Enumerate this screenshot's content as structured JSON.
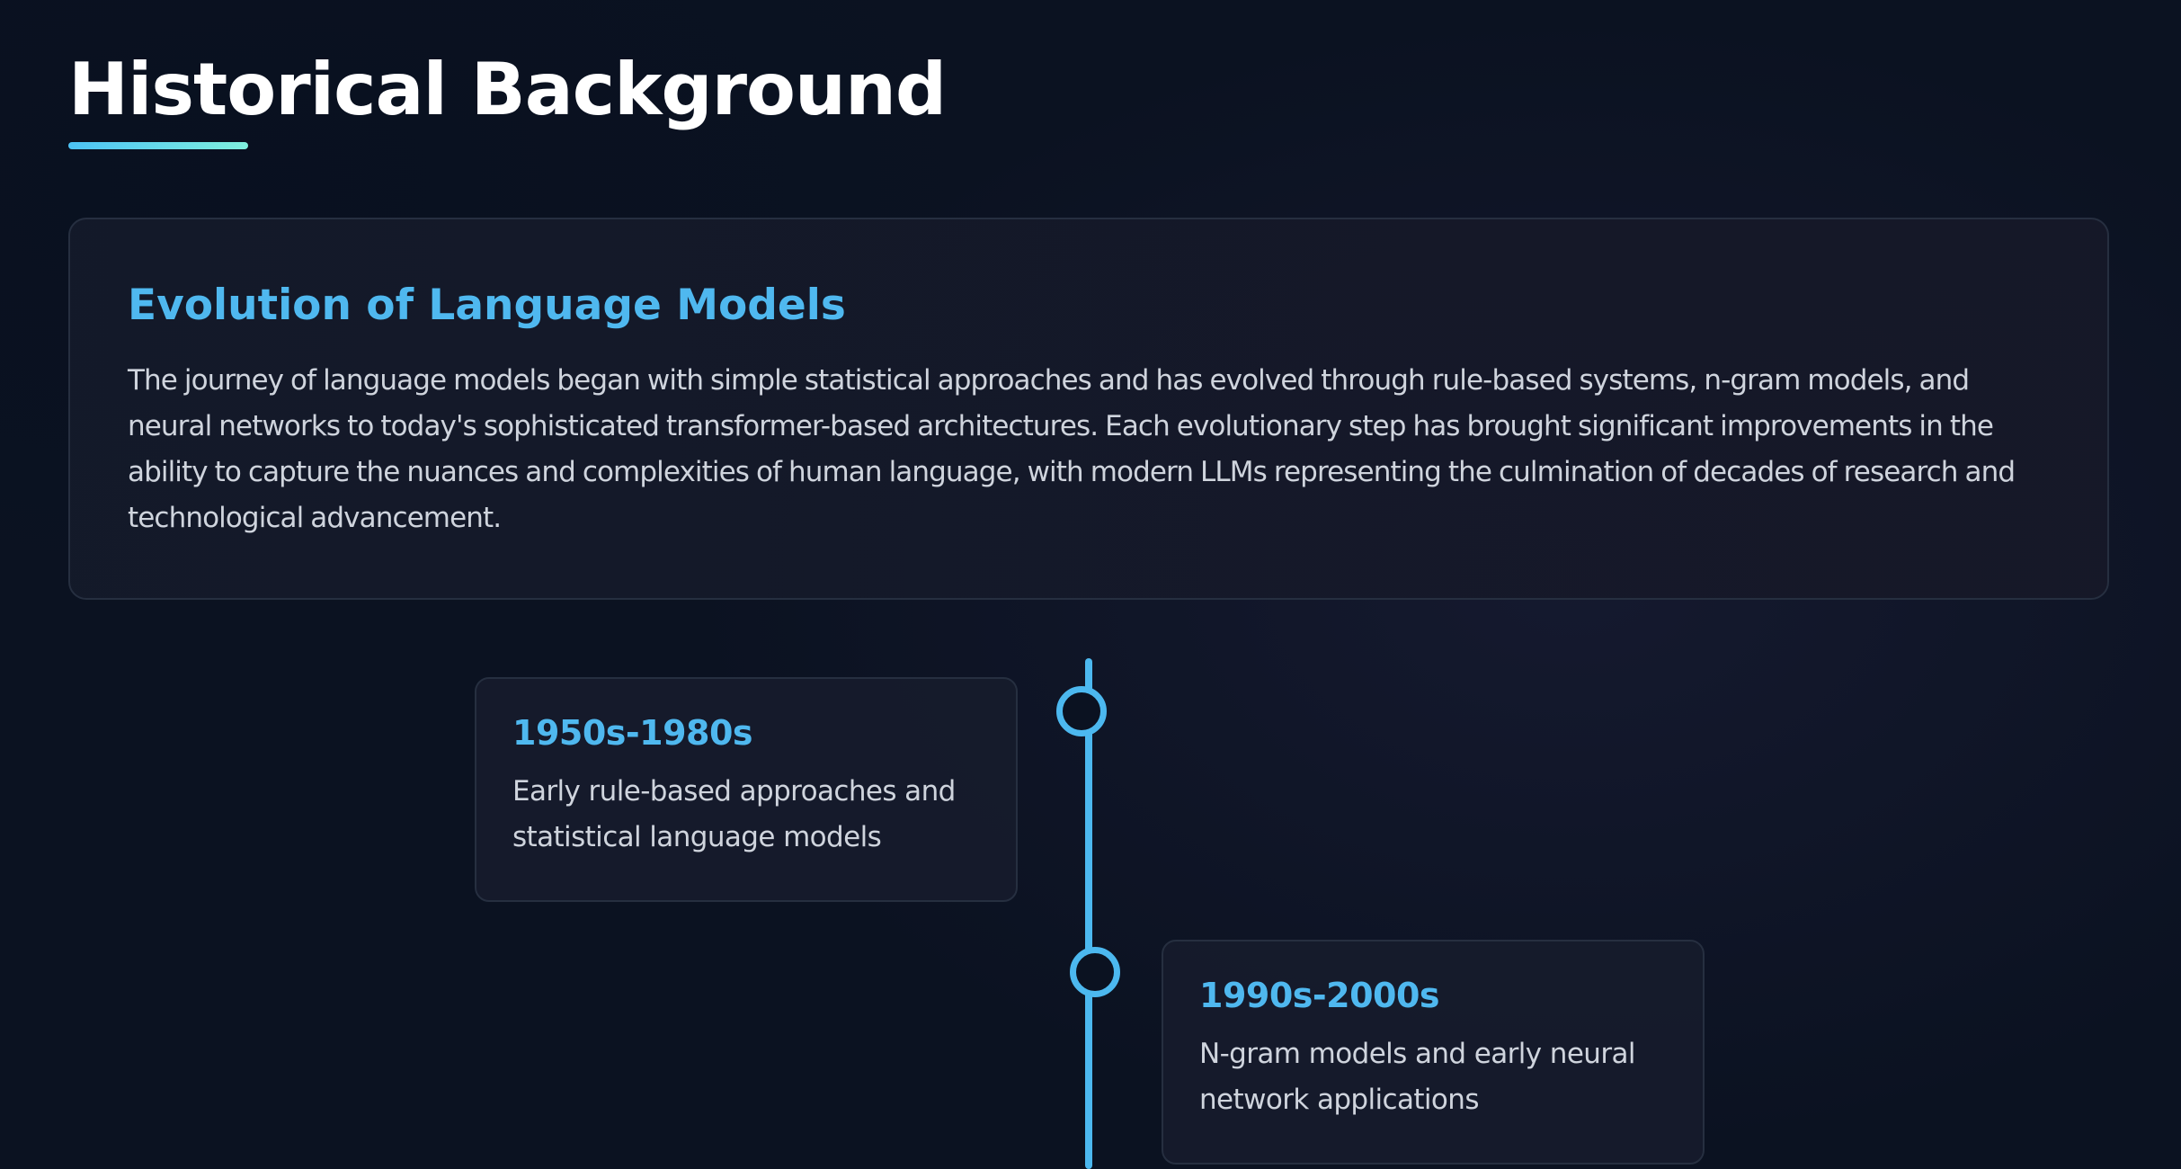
{
  "header": {
    "title": "Historical Background"
  },
  "intro": {
    "heading": "Evolution of Language Models",
    "text": "The journey of language models began with simple statistical approaches and has evolved through rule-based systems, n-gram models, and neural networks to today's sophisticated transformer-based architectures. Each evolutionary step has brought significant improvements in the ability to capture the nuances and complexities of human language, with modern LLMs representing the culmination of decades of research and technological advancement."
  },
  "timeline": {
    "items": [
      {
        "date": "1950s-1980s",
        "description": "Early rule-based approaches and statistical language models"
      },
      {
        "date": "1990s-2000s",
        "description": "N-gram models and early neural network applications"
      }
    ]
  },
  "colors": {
    "background": "#0b1221",
    "accent": "#4fb8ef",
    "accent_gradient_end": "#7ff0de",
    "text_primary": "#ffffff",
    "text_body": "#cfd4dd",
    "card_border": "#262f40"
  }
}
